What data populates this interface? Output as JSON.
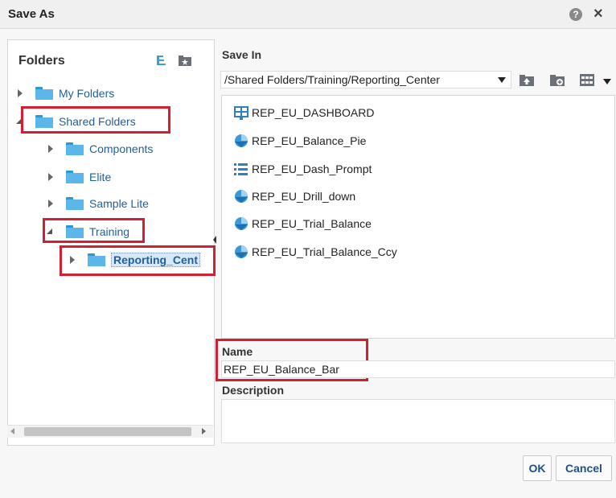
{
  "dialog": {
    "title": "Save As",
    "help_icon": "question-circle-icon",
    "close_icon": "close-icon"
  },
  "folders": {
    "title": "Folders",
    "tree": [
      {
        "label": "My Folders",
        "state": "collapsed"
      },
      {
        "label": "Shared Folders",
        "state": "expanded"
      },
      {
        "label": "Components",
        "state": "collapsed"
      },
      {
        "label": "Elite",
        "state": "collapsed"
      },
      {
        "label": "Sample Lite",
        "state": "collapsed"
      },
      {
        "label": "Training",
        "state": "expanded"
      },
      {
        "label": "Reporting_Cent",
        "state": "collapsed",
        "selected": true
      }
    ]
  },
  "save_in": {
    "label": "Save In",
    "path": "/Shared Folders/Training/Reporting_Center"
  },
  "files": [
    {
      "name": "REP_EU_DASHBOARD",
      "icon": "dashboard-icon"
    },
    {
      "name": "REP_EU_Balance_Pie",
      "icon": "analysis-icon"
    },
    {
      "name": "REP_EU_Dash_Prompt",
      "icon": "prompt-icon"
    },
    {
      "name": "REP_EU_Drill_down",
      "icon": "analysis-icon"
    },
    {
      "name": "REP_EU_Trial_Balance",
      "icon": "analysis-icon"
    },
    {
      "name": "REP_EU_Trial_Balance_Ccy",
      "icon": "analysis-icon"
    }
  ],
  "name_field": {
    "label": "Name",
    "value": "REP_EU_Balance_Bar"
  },
  "description_field": {
    "label": "Description",
    "value": ""
  },
  "buttons": {
    "ok": "OK",
    "cancel": "Cancel"
  },
  "colors": {
    "highlight_box": "#d32030",
    "folder": "#5bb6ea",
    "link_text": "#1f5f9c"
  }
}
